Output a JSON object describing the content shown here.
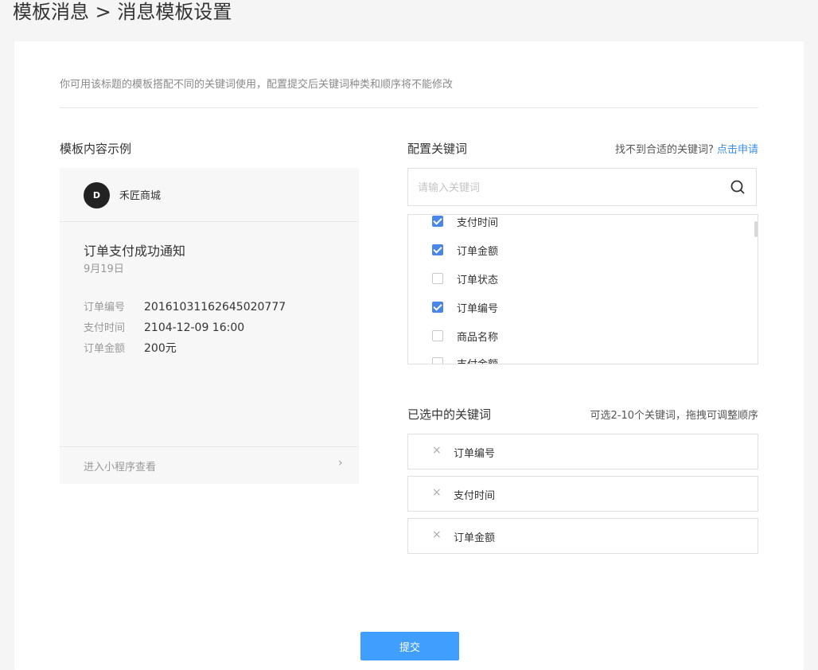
{
  "page": {
    "title": "模板消息 > 消息模板设置"
  },
  "hint": "你可用该标题的模板搭配不同的关键词使用，配置提交后关键词种类和顺序将不能修改",
  "preview": {
    "section_title": "模板内容示例",
    "shop_logo_text": "D",
    "shop_name": "禾匠商城",
    "message_title": "订单支付成功通知",
    "message_date": "9月19日",
    "fields": [
      {
        "label": "订单编号",
        "value": "20161031162645020777"
      },
      {
        "label": "支付时间",
        "value": "2104-12-09 16:00"
      },
      {
        "label": "订单金额",
        "value": "200元"
      }
    ],
    "footer_link": "进入小程序查看",
    "footer_chevron": "›"
  },
  "keywords": {
    "section_title": "配置关键词",
    "help_text": "找不到合适的关键词?",
    "help_link": "点击申请",
    "search_placeholder": "请输入关键词",
    "search_value": "",
    "items": [
      {
        "label": "支付时间",
        "checked": true
      },
      {
        "label": "订单金额",
        "checked": true
      },
      {
        "label": "订单状态",
        "checked": false
      },
      {
        "label": "订单编号",
        "checked": true
      },
      {
        "label": "商品名称",
        "checked": false
      },
      {
        "label": "支付金额",
        "checked": false
      }
    ]
  },
  "selected": {
    "section_title": "已选中的关键词",
    "hint": "可选2-10个关键词，拖拽可调整顺序",
    "remove_glyph": "×",
    "items": [
      {
        "label": "订单编号"
      },
      {
        "label": "支付时间"
      },
      {
        "label": "订单金额"
      }
    ]
  },
  "submit_label": "提交",
  "colors": {
    "accent": "#409eff",
    "link": "#3b8fe6",
    "checkbox": "#4a85e8"
  }
}
